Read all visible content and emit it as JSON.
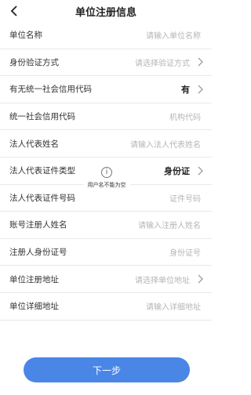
{
  "header": {
    "title": "单位注册信息"
  },
  "form": {
    "rows": [
      {
        "label": "单位名称",
        "value": "请输入单位名称"
      },
      {
        "label": "身份验证方式",
        "value": "请选择验证方式"
      },
      {
        "label": "有无统一社会信用代码",
        "value": "有"
      },
      {
        "label": "统一社会信用代码",
        "value": "机构代码"
      },
      {
        "label": "法人代表姓名",
        "value": "请输入法人代表姓名"
      },
      {
        "label": "法人代表证件类型",
        "value": "身份证"
      },
      {
        "label": "法人代表证件号码",
        "value": "证件号码"
      },
      {
        "label": "账号注册人姓名",
        "value": "请输入注册人姓名"
      },
      {
        "label": "注册人身份证号",
        "value": "身份证号"
      },
      {
        "label": "单位注册地址",
        "value": "请选择单位地址"
      },
      {
        "label": "单位详细地址",
        "value": "请输入详细地址"
      }
    ]
  },
  "toast": {
    "icon": "info-icon",
    "text": "用户名不能为空"
  },
  "footer": {
    "next_label": "下一步"
  },
  "colors": {
    "accent": "#4a86e6",
    "placeholder": "#b5b5b5"
  }
}
